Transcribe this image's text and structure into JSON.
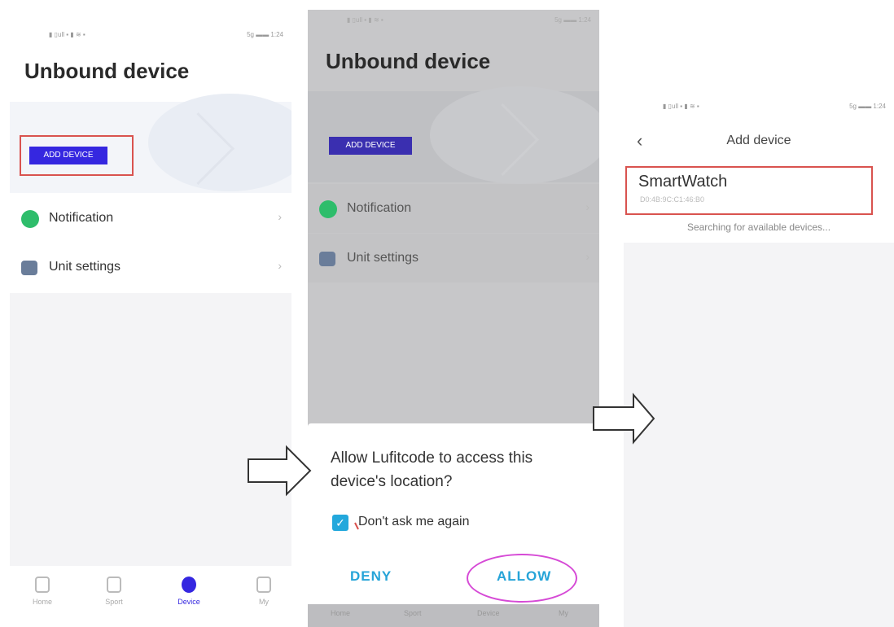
{
  "screen1": {
    "status_left": "▮ ▯ull ▪ ▮ ≋ ▪",
    "status_right": "5g ▬▬ 1:24",
    "title": "Unbound device",
    "add_button": "ADD DEVICE",
    "rows": [
      {
        "label": "Notification",
        "arrow": "›",
        "icon": "chat-bubble-icon",
        "color": "#2ebd6b"
      },
      {
        "label": "Unit settings",
        "arrow": "›",
        "icon": "settings-box-icon",
        "color": "#6a7d9a"
      }
    ],
    "tabs": [
      {
        "label": "Home",
        "icon": "home-icon"
      },
      {
        "label": "Sport",
        "icon": "sport-icon"
      },
      {
        "label": "Device",
        "icon": "device-icon",
        "active": true
      },
      {
        "label": "My",
        "icon": "profile-icon"
      }
    ]
  },
  "screen2": {
    "status_left": "▮ ▯ull ▪ ▮ ≋ ▪",
    "status_right": "5g ▬▬ 1:24",
    "title": "Unbound device",
    "add_button": "ADD DEVICE",
    "rows": [
      {
        "label": "Notification",
        "arrow": "›"
      },
      {
        "label": "Unit settings",
        "arrow": "›"
      }
    ],
    "dialog": {
      "question": "Allow Lufitcode to access this device's location?",
      "checkbox_label": "Don't ask me again",
      "checkbox_checked": true,
      "deny": "DENY",
      "allow": "ALLOW"
    },
    "tabs": [
      "Home",
      "Sport",
      "Device",
      "My"
    ]
  },
  "screen3": {
    "status_left": "▮ ▯ull ▪ ▮ ≋ ▪",
    "status_right": "5g ▬▬ 1:24",
    "nav_title": "Add device",
    "back": "‹",
    "device_name": "SmartWatch",
    "device_mac": "D0:4B:9C:C1:46:B0",
    "searching": "Searching for available devices..."
  },
  "colors": {
    "accent": "#3527e0",
    "dialog_accent": "#26a4d8",
    "highlight_red": "#d9534f",
    "highlight_magenta": "#d64ad6"
  }
}
